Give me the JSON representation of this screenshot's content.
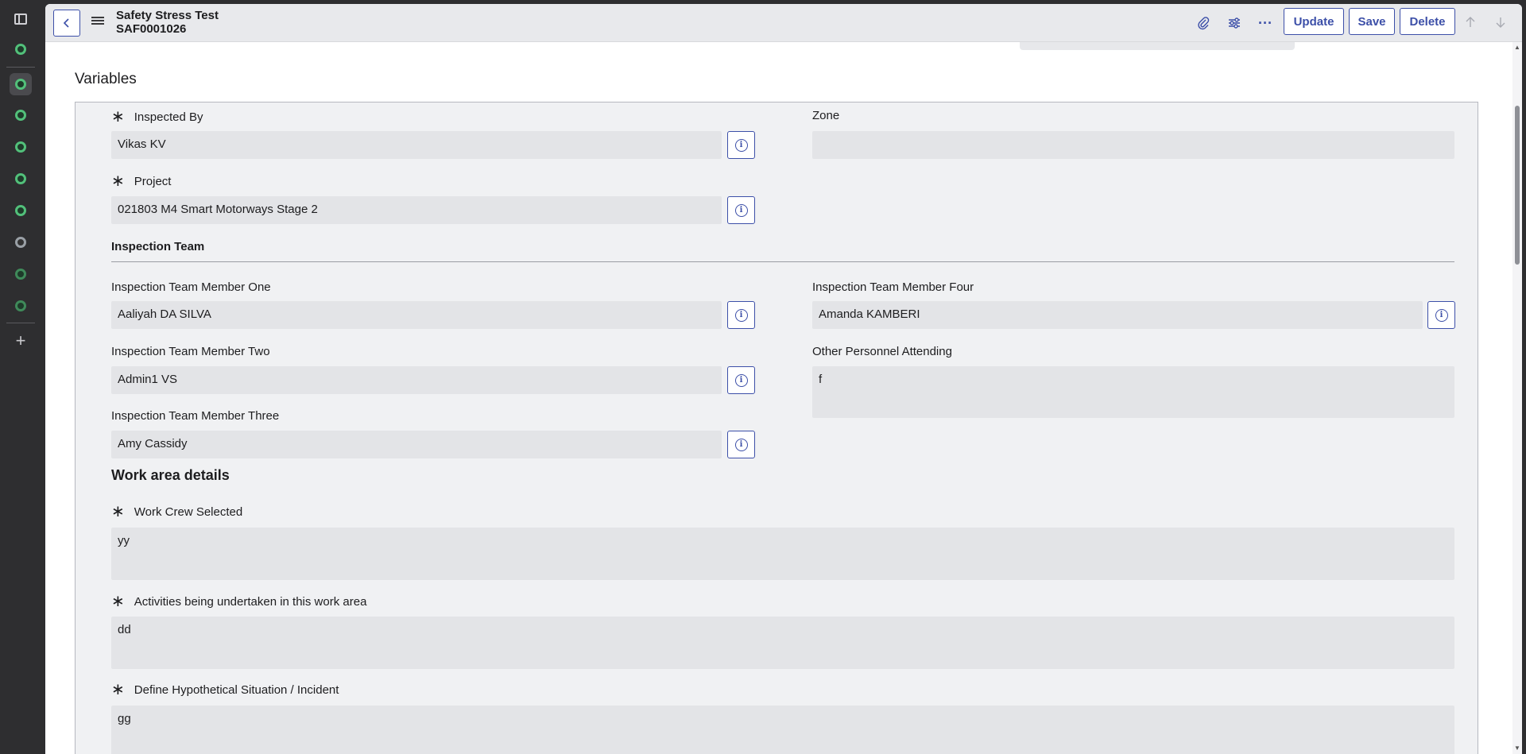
{
  "header": {
    "title": "Safety Stress Test",
    "number": "SAF0001026",
    "update_label": "Update",
    "save_label": "Save",
    "delete_label": "Delete",
    "more_label": "···"
  },
  "section": {
    "title": "Variables"
  },
  "fields": {
    "inspected_by": {
      "label": "Inspected By",
      "value": "Vikas KV"
    },
    "zone": {
      "label": "Zone",
      "value": ""
    },
    "project": {
      "label": "Project",
      "value": "021803 M4 Smart Motorways Stage 2"
    },
    "inspection_team_heading": "Inspection Team",
    "member_one": {
      "label": "Inspection Team Member One",
      "value": "Aaliyah DA SILVA"
    },
    "member_four": {
      "label": "Inspection Team Member Four",
      "value": "Amanda KAMBERI"
    },
    "member_two": {
      "label": "Inspection Team Member Two",
      "value": "Admin1 VS"
    },
    "other_personnel": {
      "label": "Other Personnel Attending",
      "value": "f"
    },
    "member_three": {
      "label": "Inspection Team Member Three",
      "value": "Amy Cassidy"
    },
    "work_area_heading": "Work area details",
    "work_crew": {
      "label": "Work Crew Selected",
      "value": "yy"
    },
    "activities": {
      "label": "Activities being undertaken in this work area",
      "value": "dd"
    },
    "hypothetical": {
      "label": "Define Hypothetical Situation / Incident",
      "value": "gg"
    }
  },
  "icons": {
    "back": "chevron-left-icon",
    "menu": "hamburger-menu-icon",
    "attach": "paperclip-icon",
    "settings": "sliders-icon",
    "more": "more-horizontal-icon",
    "up": "arrow-up-icon",
    "down": "arrow-down-icon",
    "info": "info-icon",
    "required": "asterisk-icon"
  },
  "colors": {
    "accent": "#3c4fa8",
    "rail": "#2e2e30",
    "field": "#e3e4e7",
    "panel": "#f0f1f3"
  }
}
